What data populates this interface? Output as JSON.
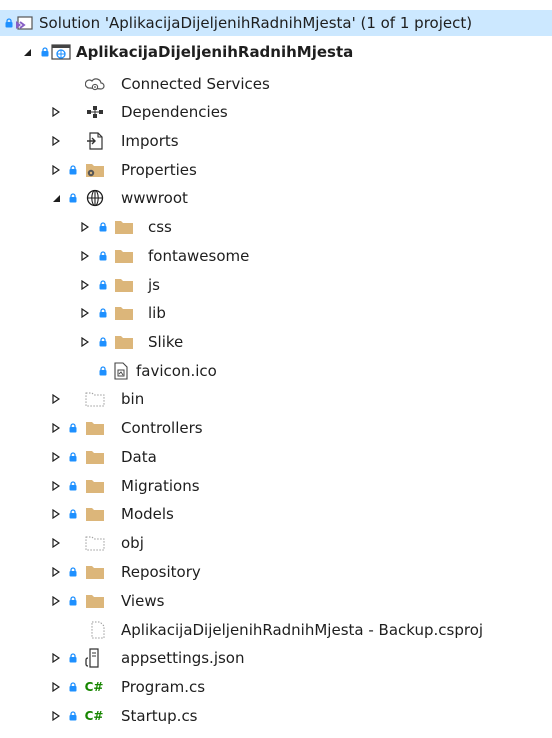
{
  "solution": {
    "label": "Solution 'AplikacijaDijeljenihRadnihMjesta' (1 of 1 project)"
  },
  "project": {
    "label": "AplikacijaDijeljenihRadnihMjesta"
  },
  "items": {
    "connected_services": "Connected Services",
    "dependencies": "Dependencies",
    "imports": "Imports",
    "properties": "Properties",
    "wwwroot": "wwwroot",
    "css": "css",
    "fontawesome": "fontawesome",
    "js": "js",
    "lib": "lib",
    "slike": "Slike",
    "favicon": "favicon.ico",
    "bin": "bin",
    "controllers": "Controllers",
    "data": "Data",
    "migrations": "Migrations",
    "models": "Models",
    "obj": "obj",
    "repository": "Repository",
    "views": "Views",
    "backup_csproj": "AplikacijaDijeljenihRadnihMjesta - Backup.csproj",
    "appsettings": "appsettings.json",
    "program": "Program.cs",
    "startup": "Startup.cs"
  },
  "colors": {
    "selection": "#cce8ff",
    "folder": "#dcb67a",
    "lock": "#1e90ff",
    "csharp": "#178600"
  },
  "icons": {
    "csharp_glyph": "C#"
  }
}
